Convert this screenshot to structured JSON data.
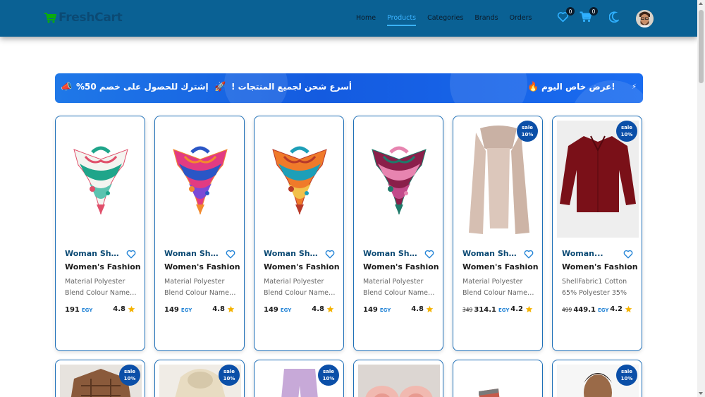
{
  "brand": {
    "name": "FreshCart",
    "icon": "cart-icon"
  },
  "nav": {
    "links": [
      {
        "label": "Home",
        "active": false
      },
      {
        "label": "Products",
        "active": true
      },
      {
        "label": "Categories",
        "active": false
      },
      {
        "label": "Brands",
        "active": false
      },
      {
        "label": "Orders",
        "active": false
      }
    ],
    "wishlist_count": "0",
    "cart_count": "0",
    "icons": [
      "heart-icon",
      "cart-icon",
      "moon-icon",
      "avatar"
    ]
  },
  "promo": {
    "offer": "!عرض خاص اليوم",
    "shipping": "أسرع شحن لجميع المنتجات !",
    "subscribe": "إشترك للحصول على خصم 50%"
  },
  "colors": {
    "navbar": "#0a6194",
    "accent": "#3bb3ff",
    "title": "#0b4a74",
    "card_border": "#1d6fb8",
    "sale_badge": "#0b4fa8",
    "star": "#f5b301"
  },
  "products": [
    {
      "title": "Woman Shawl",
      "category": "Women's Fashion",
      "desc1": "Material Polyester",
      "desc2": "Blend Colour Name…",
      "price": "191",
      "old_price": "",
      "currency": "EGY",
      "rating": "4.8",
      "sale": false,
      "image": "scarf-white-green"
    },
    {
      "title": "Woman Shawl",
      "category": "Women's Fashion",
      "desc1": "Material Polyester",
      "desc2": "Blend Colour Name…",
      "price": "149",
      "old_price": "",
      "currency": "EGY",
      "rating": "4.8",
      "sale": false,
      "image": "scarf-pink-blue"
    },
    {
      "title": "Woman Shawl",
      "category": "Women's Fashion",
      "desc1": "Material Polyester",
      "desc2": "Blend Colour Name…",
      "price": "149",
      "old_price": "",
      "currency": "EGY",
      "rating": "4.8",
      "sale": false,
      "image": "scarf-orange-teal"
    },
    {
      "title": "Woman Shawl",
      "category": "Women's Fashion",
      "desc1": "Material Polyester",
      "desc2": "Blend Colour Name…",
      "price": "149",
      "old_price": "",
      "currency": "EGY",
      "rating": "4.8",
      "sale": false,
      "image": "scarf-maroon-pink"
    },
    {
      "title": "Woman Shawl",
      "category": "Women's Fashion",
      "desc1": "Material Polyester",
      "desc2": "Blend Colour Name…",
      "price": "314.1",
      "old_price": "349",
      "currency": "EGY",
      "rating": "4.2",
      "sale": true,
      "image": "shawl-beige"
    },
    {
      "title": "Woman...",
      "category": "Women's Fashion",
      "desc1": "ShellFabric1 Cotton",
      "desc2": "65% Polyester 35%",
      "price": "449.1",
      "old_price": "499",
      "currency": "EGY",
      "rating": "4.2",
      "sale": true,
      "image": "shirt-maroon"
    }
  ],
  "sale_label": {
    "line1": "sale",
    "line2": "10%"
  },
  "row2_products": [
    {
      "sale": true,
      "image": "jacket-brown-plaid"
    },
    {
      "sale": true,
      "image": "hoodie-cream"
    },
    {
      "sale": true,
      "image": "pants-lilac"
    },
    {
      "sale": false,
      "image": "slippers-pink"
    },
    {
      "sale": false,
      "image": "box-product"
    },
    {
      "sale": true,
      "image": "man-portrait"
    }
  ]
}
